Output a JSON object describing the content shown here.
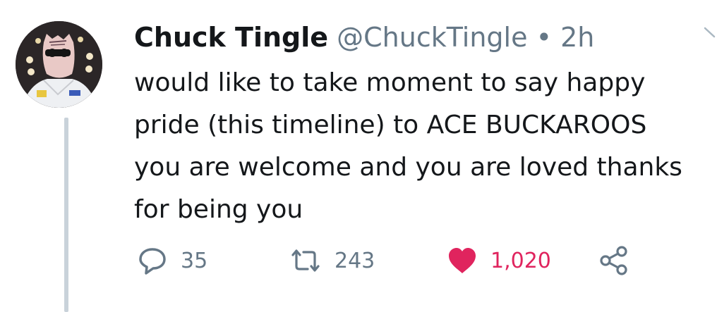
{
  "tweet": {
    "author": {
      "display_name": "Chuck Tingle",
      "handle": "@ChuckTingle",
      "avatar": "avatar-photo"
    },
    "separator": "•",
    "timestamp": "2h",
    "text_lines": [
      "would like to take moment to say happy",
      "pride (this timeline) to ACE BUCKAROOS",
      "you are welcome and you are loved thanks",
      "for being you"
    ],
    "actions": {
      "reply": {
        "icon": "reply-icon",
        "count": "35"
      },
      "retweet": {
        "icon": "retweet-icon",
        "count": "243"
      },
      "like": {
        "icon": "heart-icon",
        "count": "1,020",
        "liked": true
      },
      "share": {
        "icon": "share-icon"
      }
    },
    "more_icon": "chevron-down-icon"
  },
  "colors": {
    "text": "#14171a",
    "secondary": "#657786",
    "like": "#e0245e",
    "thread_line": "#c9d2da"
  }
}
